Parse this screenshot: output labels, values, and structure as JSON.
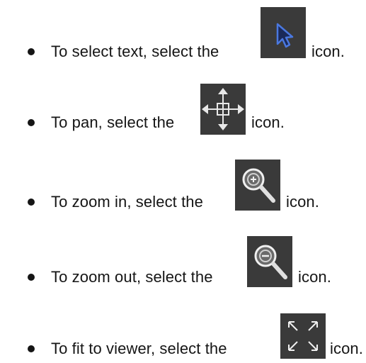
{
  "items": [
    {
      "text": "To select text, select the",
      "suffix": "icon.",
      "icon": "pointer-arrow-icon"
    },
    {
      "text": "To pan, select the",
      "suffix": "icon.",
      "icon": "pan-arrows-icon"
    },
    {
      "text": "To zoom in, select the",
      "suffix": "icon.",
      "icon": "zoom-in-icon"
    },
    {
      "text": "To zoom out, select the",
      "suffix": "icon.",
      "icon": "zoom-out-icon"
    },
    {
      "text": "To fit to viewer, select the",
      "suffix": "icon.",
      "icon": "fit-to-viewer-icon"
    }
  ]
}
